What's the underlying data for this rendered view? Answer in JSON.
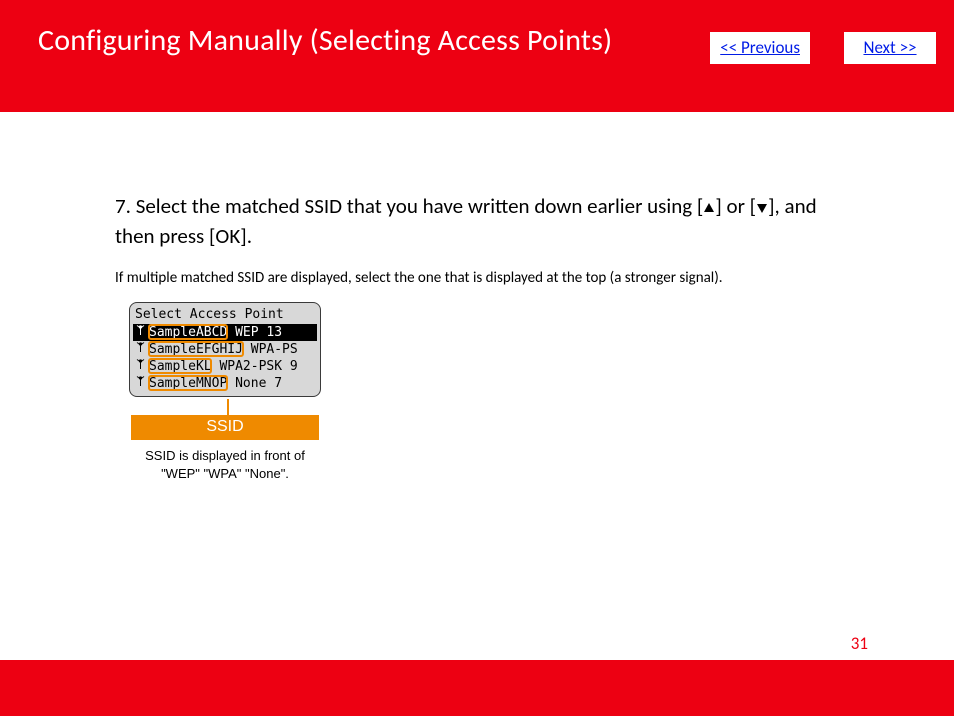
{
  "header": {
    "title": "Configuring Manually (Selecting Access Points)",
    "prev": "<< Previous",
    "next": "Next >>"
  },
  "step": {
    "num": "7.",
    "part1": "Select the matched SSID that you have written down earlier using [",
    "part2": "] or [",
    "part3": "], and then press [OK]."
  },
  "note": "If multiple matched SSID are displayed, select the one that is displayed at the top (a stronger signal).",
  "panel": {
    "title": "Select Access Point",
    "rows": [
      {
        "ssid": "SampleABCD",
        "rest": " WEP 13"
      },
      {
        "ssid": "SampleEFGHIJ",
        "rest": " WPA-PS"
      },
      {
        "ssid": "SampleKL",
        "rest": " WPA2-PSK 9"
      },
      {
        "ssid": "SampleMNOP",
        "rest": " None 7"
      }
    ]
  },
  "ssid_box": {
    "label": "SSID",
    "caption": "SSID is displayed in front of \"WEP\" \"WPA\" \"None\"."
  },
  "page_number": "31"
}
